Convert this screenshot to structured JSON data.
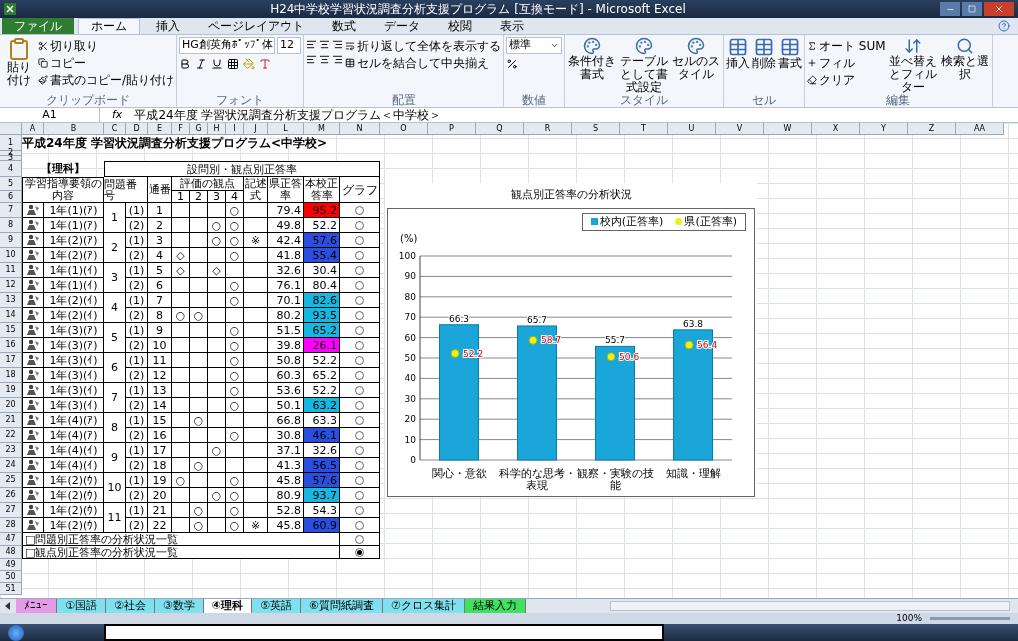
{
  "window": {
    "title": "H24中学校学習状況調査分析支援プログラム [互換モード] - Microsoft Excel"
  },
  "ribbon": {
    "tabs": [
      {
        "label": "ファイル",
        "kind": "file",
        "selected": false
      },
      {
        "label": "ホーム",
        "selected": true
      },
      {
        "label": "挿入",
        "selected": false
      },
      {
        "label": "ページレイアウト",
        "selected": false
      },
      {
        "label": "数式",
        "selected": false
      },
      {
        "label": "データ",
        "selected": false
      },
      {
        "label": "校閲",
        "selected": false
      },
      {
        "label": "表示",
        "selected": false
      }
    ],
    "clipboard": {
      "label": "クリップボード",
      "paste": "貼り付け",
      "items": [
        "切り取り",
        "コピー",
        "書式のコピー/貼り付け"
      ]
    },
    "font": {
      "label": "フォント",
      "name": "HG創英角ﾎﾟｯﾌﾟ体",
      "size": "12"
    },
    "alignment": {
      "label": "配置",
      "items": [
        "折り返して全体を表示する",
        "セルを結合して中央揃え"
      ]
    },
    "number": {
      "label": "数値",
      "format": "標準"
    },
    "styles": {
      "label": "スタイル",
      "items": [
        "条件付き書式",
        "テーブルとして書式設定",
        "セルのスタイル"
      ]
    },
    "cells": {
      "label": "セル",
      "items": [
        "挿入",
        "削除",
        "書式"
      ]
    },
    "editing": {
      "label": "編集",
      "items": [
        "オート SUM",
        "フィル",
        "クリア"
      ],
      "big": [
        "並べ替えとフィルター",
        "検索と選択"
      ]
    }
  },
  "formula_bar": {
    "name_box": "A1",
    "fx": "fx",
    "formula": "平成24年度 学習状況調査分析支援プログラム＜中学校＞"
  },
  "columns": [
    "A",
    "B",
    "C",
    "D",
    "E",
    "F",
    "G",
    "H",
    "I",
    "J",
    "L",
    "M",
    "N"
  ],
  "more_columns": [
    "O",
    "P",
    "Q",
    "R",
    "S",
    "T",
    "U",
    "V",
    "W",
    "X",
    "Y",
    "Z",
    "AA"
  ],
  "row_numbers": [
    "1",
    "2",
    "3",
    "4",
    "5",
    "6",
    "7",
    "8",
    "9",
    "10",
    "11",
    "12",
    "13",
    "14",
    "15",
    "16",
    "17",
    "18",
    "19",
    "20",
    "21",
    "22",
    "23",
    "24",
    "25",
    "26",
    "27",
    "28",
    "47",
    "48",
    "49",
    "50",
    "51"
  ],
  "sheet_title": "平成24年度 学習状況調査分析支援プログラム<中学校>",
  "subject": "【理科】",
  "table_header": {
    "title": "設問別・観点別正答率",
    "content": "学習指導要領の内容",
    "problem": "問題番号",
    "serial": "通番",
    "viewpoints": "評価の観点",
    "viewpoint_numbers": [
      "1",
      "2",
      "3",
      "4"
    ],
    "written": "記述式",
    "pref": "県正答率",
    "school": "本校正答率",
    "graph": "グラフ"
  },
  "groups": [
    {
      "number": "1",
      "items": [
        {
          "content": "1年(1)(ｱ)",
          "sub": "(1)",
          "serial": "1",
          "marks": {
            "v4": "○"
          },
          "pref": "79.4",
          "school": "95.2",
          "color": "#ff0000",
          "selected": false
        },
        {
          "content": "1年(1)(ｱ)",
          "sub": "(2)",
          "serial": "2",
          "marks": {
            "v3": "○",
            "v4": "○"
          },
          "pref": "49.8",
          "school": "52.2",
          "selected": false
        }
      ]
    },
    {
      "number": "2",
      "items": [
        {
          "content": "1年(2)(ｱ)",
          "sub": "(1)",
          "serial": "3",
          "marks": {
            "v3": "○",
            "v4": "○"
          },
          "written": "※",
          "pref": "42.4",
          "school": "57.6",
          "color": "#2a4fe0",
          "selected": false
        },
        {
          "content": "1年(2)(ｱ)",
          "sub": "(2)",
          "serial": "4",
          "marks": {
            "v1": "◇",
            "v4": "○"
          },
          "pref": "41.8",
          "school": "55.4",
          "color": "#2a4fe0",
          "selected": false
        }
      ]
    },
    {
      "number": "3",
      "items": [
        {
          "content": "1年(1)(ｲ)",
          "sub": "(1)",
          "serial": "5",
          "marks": {
            "v1": "◇",
            "v3": "◇"
          },
          "pref": "32.6",
          "school": "30.4",
          "selected": false
        },
        {
          "content": "1年(1)(ｲ)",
          "sub": "(2)",
          "serial": "6",
          "marks": {
            "v4": "○"
          },
          "pref": "76.1",
          "school": "80.4",
          "selected": false
        }
      ]
    },
    {
      "number": "4",
      "items": [
        {
          "content": "1年(2)(ｲ)",
          "sub": "(1)",
          "serial": "7",
          "marks": {
            "v4": "○"
          },
          "pref": "70.1",
          "school": "82.6",
          "color": "#14b8e0",
          "selected": false
        },
        {
          "content": "1年(2)(ｲ)",
          "sub": "(2)",
          "serial": "8",
          "marks": {
            "v1": "○",
            "v2": "○"
          },
          "pref": "80.2",
          "school": "93.5",
          "color": "#14b8e0",
          "selected": false
        }
      ]
    },
    {
      "number": "5",
      "items": [
        {
          "content": "1年(3)(ｱ)",
          "sub": "(1)",
          "serial": "9",
          "marks": {
            "v4": "○"
          },
          "pref": "51.5",
          "school": "65.2",
          "color": "#14b8e0",
          "selected": false
        },
        {
          "content": "1年(3)(ｱ)",
          "sub": "(2)",
          "serial": "10",
          "marks": {
            "v4": "○"
          },
          "pref": "39.8",
          "school": "26.1",
          "color": "#ff00ff",
          "selected": false
        }
      ]
    },
    {
      "number": "6",
      "items": [
        {
          "content": "1年(3)(ｲ)",
          "sub": "(1)",
          "serial": "11",
          "marks": {
            "v4": "○"
          },
          "pref": "50.8",
          "school": "52.2",
          "selected": false
        },
        {
          "content": "1年(3)(ｲ)",
          "sub": "(2)",
          "serial": "12",
          "marks": {
            "v4": "○"
          },
          "pref": "60.3",
          "school": "65.2",
          "selected": false
        }
      ]
    },
    {
      "number": "7",
      "items": [
        {
          "content": "1年(3)(ｲ)",
          "sub": "(1)",
          "serial": "13",
          "marks": {
            "v4": "○"
          },
          "pref": "53.6",
          "school": "52.2",
          "selected": false
        },
        {
          "content": "1年(3)(ｲ)",
          "sub": "(2)",
          "serial": "14",
          "marks": {
            "v4": "○"
          },
          "pref": "50.1",
          "school": "63.2",
          "color": "#14b8e0",
          "selected": false
        }
      ]
    },
    {
      "number": "8",
      "items": [
        {
          "content": "1年(4)(ｱ)",
          "sub": "(1)",
          "serial": "15",
          "marks": {
            "v2": "○"
          },
          "pref": "66.8",
          "school": "63.3",
          "selected": false
        },
        {
          "content": "1年(4)(ｱ)",
          "sub": "(2)",
          "serial": "16",
          "marks": {
            "v4": "○"
          },
          "pref": "30.8",
          "school": "46.1",
          "color": "#2a4fe0",
          "selected": false
        }
      ]
    },
    {
      "number": "9",
      "items": [
        {
          "content": "1年(4)(ｲ)",
          "sub": "(1)",
          "serial": "17",
          "marks": {
            "v3": "○"
          },
          "pref": "37.1",
          "school": "32.6",
          "selected": false
        },
        {
          "content": "1年(4)(ｲ)",
          "sub": "(2)",
          "serial": "18",
          "marks": {
            "v2": "○"
          },
          "pref": "41.3",
          "school": "56.5",
          "color": "#2a4fe0",
          "selected": false
        }
      ]
    },
    {
      "number": "10",
      "items": [
        {
          "content": "1年(2)(ｳ)",
          "sub": "(1)",
          "serial": "19",
          "marks": {
            "v1": "○",
            "v4": "○"
          },
          "pref": "45.8",
          "school": "57.6",
          "color": "#2a4fe0",
          "selected": false
        },
        {
          "content": "1年(2)(ｳ)",
          "sub": "(2)",
          "serial": "20",
          "marks": {
            "v3": "○",
            "v4": "○"
          },
          "pref": "80.9",
          "school": "93.7",
          "color": "#14b8e0",
          "selected": false
        }
      ]
    },
    {
      "number": "11",
      "items": [
        {
          "content": "1年(2)(ｳ)",
          "sub": "(1)",
          "serial": "21",
          "marks": {
            "v2": "○",
            "v4": "○"
          },
          "pref": "52.8",
          "school": "54.3",
          "selected": false
        },
        {
          "content": "1年(2)(ｳ)",
          "sub": "(2)",
          "serial": "22",
          "marks": {
            "v2": "○",
            "v4": "○"
          },
          "written": "※",
          "pref": "45.8",
          "school": "60.9",
          "color": "#2a4fe0",
          "selected": false
        }
      ]
    }
  ],
  "lists": [
    {
      "label": "□問題別正答率の分析状況一覧",
      "selected": false
    },
    {
      "label": "□観点別正答率の分析状況一覧",
      "selected": true
    }
  ],
  "chart": {
    "chart_data": {
      "type": "bar",
      "title": "観点別正答率の分析状況",
      "ylabel": "(%)",
      "categories": [
        "関心・意欲",
        "科学的な思考・表現",
        "観察・実験の技能",
        "知識・理解"
      ],
      "series": [
        {
          "name": "校内(正答率)",
          "color": "#1aa6d8",
          "values": [
            66.3,
            65.7,
            55.7,
            63.8
          ]
        },
        {
          "name": "県(正答率)",
          "type": "scatter",
          "color": "#e8f020",
          "values": [
            52.2,
            58.7,
            50.6,
            56.4
          ]
        }
      ],
      "ylim": [
        0,
        100
      ],
      "yticks": [
        0,
        10,
        20,
        30,
        40,
        50,
        60,
        70,
        80,
        90,
        100
      ],
      "data_labels": true,
      "grid": true,
      "legend": true
    }
  },
  "sheet_tabs": [
    {
      "label": "ﾒﾆｭｰ",
      "color": "#e59ae8",
      "selected": false
    },
    {
      "label": "①国語",
      "color": "#7fe0f0",
      "selected": false
    },
    {
      "label": "②社会",
      "color": "#7fe0f0",
      "selected": false
    },
    {
      "label": "③数学",
      "color": "#7fe0f0",
      "selected": false
    },
    {
      "label": "④理科",
      "color": "#ffffff",
      "selected": true
    },
    {
      "label": "⑤英語",
      "color": "#7fe0f0",
      "selected": false
    },
    {
      "label": "⑥質問紙調査",
      "color": "#7fe0f0",
      "selected": false
    },
    {
      "label": "⑦クロス集計",
      "color": "#7fe0f0",
      "selected": false
    },
    {
      "label": "結果入力",
      "color": "#40e060",
      "selected": false
    }
  ],
  "status_bar": {
    "zoom": "100%"
  }
}
